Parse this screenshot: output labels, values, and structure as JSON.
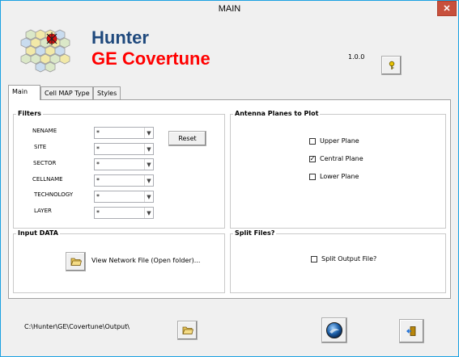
{
  "window": {
    "title": "MAIN",
    "close_glyph": "✕"
  },
  "branding": {
    "name_line1": "Hunter",
    "name_line2": "GE Covertune",
    "version": "1.0.0",
    "logo_icon": "hexagon-grid-logo-icon"
  },
  "tabs": [
    {
      "label": "Main",
      "active": true
    },
    {
      "label": "Cell MAP Type",
      "active": false
    },
    {
      "label": "Styles",
      "active": false
    }
  ],
  "filters": {
    "title": "Filters",
    "reset_label": "Reset",
    "rows": [
      {
        "label": "NENAME",
        "value": "*"
      },
      {
        "label": "SITE",
        "value": "*"
      },
      {
        "label": "SECTOR",
        "value": "*"
      },
      {
        "label": "CELLNAME",
        "value": "*"
      },
      {
        "label": "TECHNOLOGY",
        "value": "*"
      },
      {
        "label": "LAYER",
        "value": "*"
      }
    ]
  },
  "antenna_planes": {
    "title": "Antenna Planes to Plot",
    "options": [
      {
        "label": "Upper Plane",
        "checked": false
      },
      {
        "label": "Central Plane",
        "checked": true
      },
      {
        "label": "Lower Plane",
        "checked": false
      }
    ]
  },
  "input_data": {
    "title": "Input DATA",
    "link_label": "View Network File (Open folder)..."
  },
  "split_files": {
    "title": "Split Files?",
    "option_label": "Split Output File?",
    "checked": false
  },
  "footer": {
    "output_path": "C:\\Hunter\\GE\\Covertune\\Output\\"
  },
  "icons": {
    "key": "key-icon",
    "open_folder": "open-folder-icon",
    "run": "run-globe-icon",
    "exit": "exit-door-icon"
  },
  "colors": {
    "brand_blue": "#1f497d",
    "brand_red": "#ff0000",
    "window_border": "#1ba1e2",
    "close_button": "#c7503c"
  }
}
